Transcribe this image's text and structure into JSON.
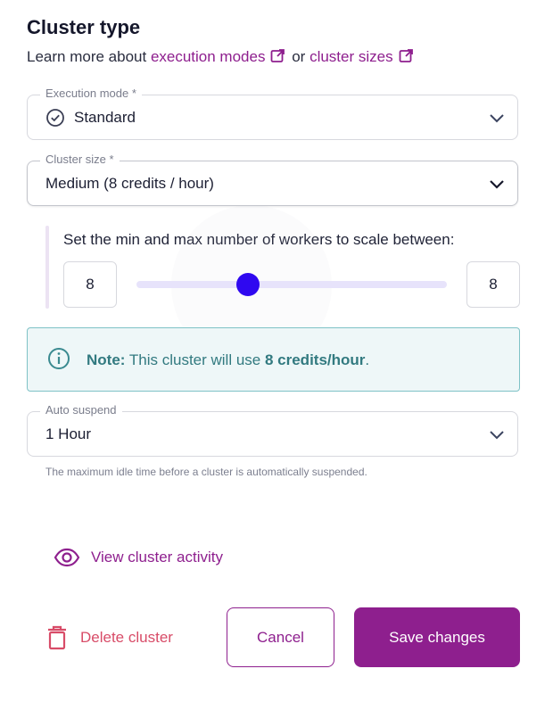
{
  "header": {
    "title": "Cluster type",
    "learn_prefix": "Learn more about",
    "link_execution_modes": "execution modes",
    "or_text": "or",
    "link_cluster_sizes": "cluster sizes",
    "external_link_icon": "external-link-icon"
  },
  "execution_mode": {
    "label": "Execution mode *",
    "value": "Standard",
    "icon": "check-circle-icon"
  },
  "cluster_size": {
    "label": "Cluster size *",
    "value": "Medium (8 credits / hour)"
  },
  "workers": {
    "title": "Set the min and max number of workers to scale between:",
    "min": "8",
    "max": "8",
    "slider_fraction": 0.36
  },
  "note": {
    "prefix": "Note:",
    "text": "This cluster will use",
    "credits": "8 credits/hour",
    "suffix": "."
  },
  "auto_suspend": {
    "label": "Auto suspend",
    "value": "1 Hour",
    "help": "The maximum idle time before a cluster is automatically suspended."
  },
  "actions": {
    "view_activity": "View cluster activity",
    "delete": "Delete cluster",
    "cancel": "Cancel",
    "save": "Save changes"
  },
  "colors": {
    "brand": "#8e1f8e",
    "slider_thumb": "#2f08f0",
    "note_text": "#327a80",
    "delete": "#d84c68"
  }
}
